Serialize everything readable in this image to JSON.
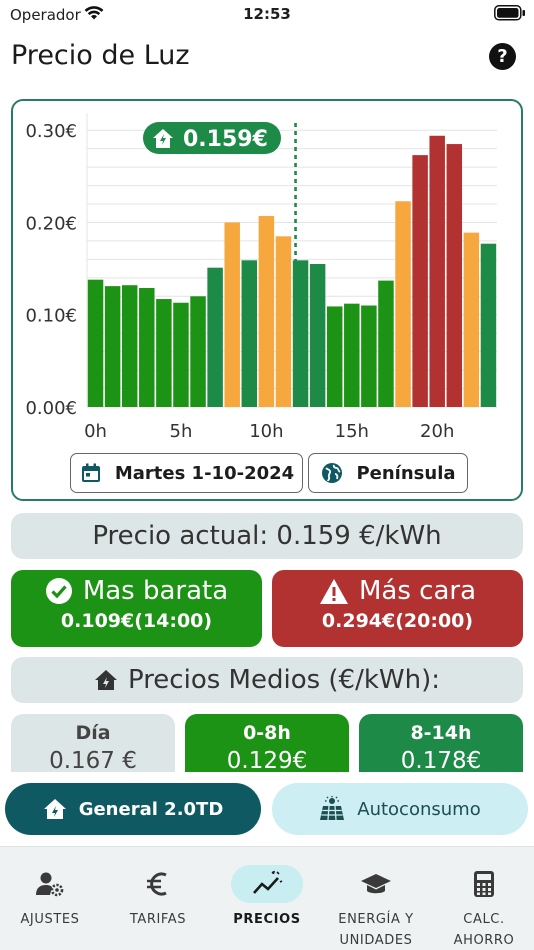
{
  "status": {
    "carrier": "Operador",
    "time": "12:53"
  },
  "header": {
    "title": "Precio de Luz",
    "help_icon": "question-circle-icon"
  },
  "chart_data": {
    "type": "bar",
    "categories": [
      "0h",
      "1h",
      "2h",
      "3h",
      "4h",
      "5h",
      "6h",
      "7h",
      "8h",
      "9h",
      "10h",
      "11h",
      "12h",
      "13h",
      "14h",
      "15h",
      "16h",
      "17h",
      "18h",
      "19h",
      "20h",
      "21h",
      "22h",
      "23h"
    ],
    "values": [
      0.138,
      0.131,
      0.132,
      0.129,
      0.117,
      0.113,
      0.12,
      0.151,
      0.2,
      0.159,
      0.207,
      0.185,
      0.159,
      0.155,
      0.109,
      0.112,
      0.11,
      0.137,
      0.223,
      0.273,
      0.294,
      0.285,
      0.189,
      0.177
    ],
    "x_tick_labels": [
      "0h",
      "5h",
      "10h",
      "15h",
      "20h"
    ],
    "y_tick_labels": [
      "0.00€",
      "0.10€",
      "0.20€",
      "0.30€"
    ],
    "y_ticks": [
      0,
      0.1,
      0.2,
      0.3
    ],
    "ylim": [
      0,
      0.31
    ],
    "current_hour_index": 12,
    "current_marker_label": "0.159€",
    "colors": {
      "cheap": "#1d9316",
      "mid_green": "#1d8a47",
      "medium": "#f6a83f",
      "expensive": "#b23232"
    },
    "grid": true
  },
  "chart_controls": {
    "date": "Martes 1-10-2024",
    "region": "Península",
    "date_icon": "calendar-icon",
    "region_icon": "globe-icon"
  },
  "current_price": "Precio actual: 0.159 €/kWh",
  "cheapest": {
    "title": "Mas barata",
    "value": "0.109€(14:00)",
    "icon": "check-circle-icon"
  },
  "most_expensive": {
    "title": "Más cara",
    "value": "0.294€(20:00)",
    "icon": "warning-icon"
  },
  "averages": {
    "title": "Precios Medios (€/kWh):",
    "items": [
      {
        "label": "Día",
        "value": "0.167 €"
      },
      {
        "label": "0-8h",
        "value": "0.129€"
      },
      {
        "label": "8-14h",
        "value": "0.178€"
      }
    ]
  },
  "tariff_toggle": {
    "general": "General 2.0TD",
    "self": "Autoconsumo"
  },
  "tabs": [
    {
      "label": "AJUSTES",
      "icon": "user-settings-icon"
    },
    {
      "label": "TARIFAS",
      "icon": "euro-icon"
    },
    {
      "label": "PRECIOS",
      "icon": "trend-icon"
    },
    {
      "label_l1": "ENERGÍA Y",
      "label_l2": "UNIDADES",
      "icon": "school-cap-icon"
    },
    {
      "label_l1": "CALC.",
      "label_l2": "AHORRO",
      "icon": "calculator-icon"
    }
  ]
}
